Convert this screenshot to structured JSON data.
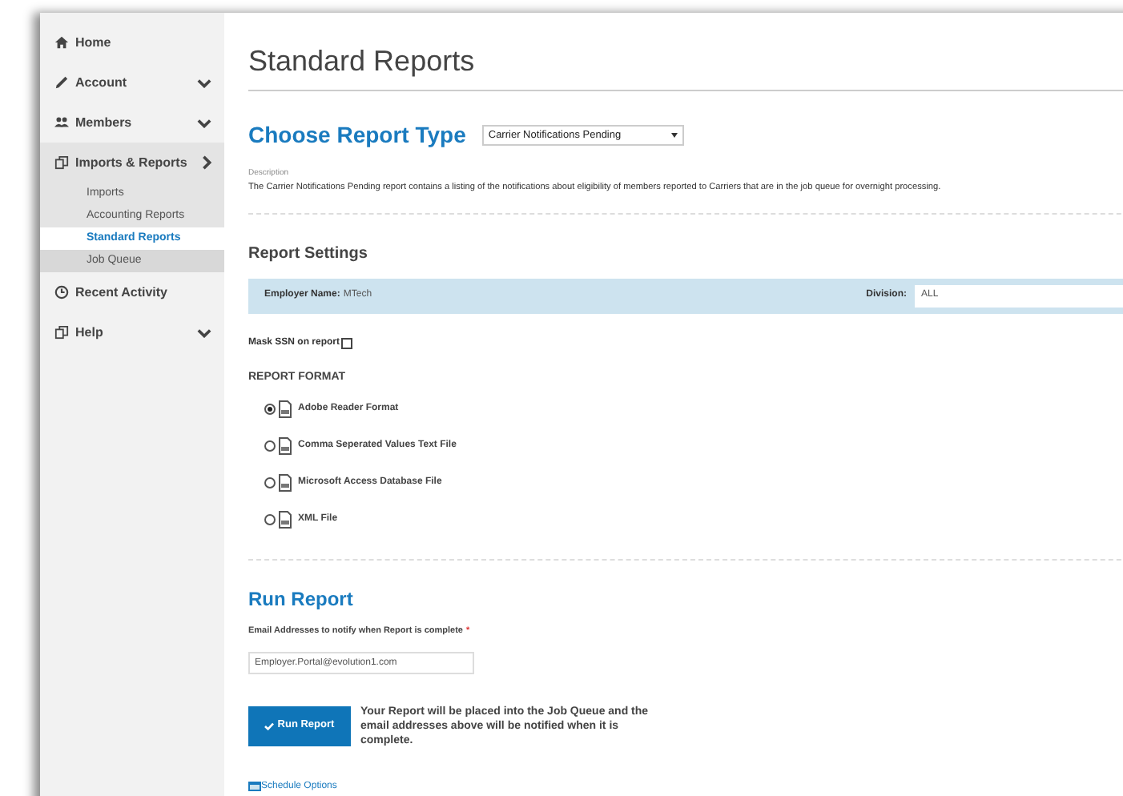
{
  "sidebar": {
    "items": [
      {
        "label": "Home",
        "kind": "home",
        "expandable": false,
        "expanded": false
      },
      {
        "label": "Account",
        "kind": "pencil",
        "expandable": true,
        "expanded": false
      },
      {
        "label": "Members",
        "kind": "users",
        "expandable": true,
        "expanded": false
      },
      {
        "label": "Imports & Reports",
        "kind": "copy",
        "expandable": true,
        "expanded": true,
        "children": [
          {
            "label": "Imports",
            "selected": false,
            "hovered": false
          },
          {
            "label": "Accounting Reports",
            "selected": false,
            "hovered": false
          },
          {
            "label": "Standard Reports",
            "selected": true,
            "hovered": false
          },
          {
            "label": "Job Queue",
            "selected": false,
            "hovered": true
          }
        ]
      },
      {
        "label": "Recent Activity",
        "kind": "clock",
        "expandable": false,
        "expanded": false
      },
      {
        "label": "Help",
        "kind": "copy",
        "expandable": true,
        "expanded": false
      }
    ]
  },
  "page_title": "Standard Reports",
  "choose": {
    "heading": "Choose Report Type",
    "select_value": "Carrier Notifications Pending",
    "description_label": "Description",
    "description": "The Carrier Notifications Pending report contains a listing of the notifications about eligibility of members reported to Carriers that are in the job queue for overnight processing."
  },
  "settings": {
    "heading": "Report Settings",
    "employer_label": "Employer Name:",
    "employer_value": "MTech",
    "division_label": "Division:",
    "division_value": "ALL",
    "mask_label": "Mask SSN on report",
    "mask_checked": false,
    "format_heading": "REPORT FORMAT",
    "formats": [
      {
        "label": "Adobe Reader Format",
        "selected": true
      },
      {
        "label": "Comma Seperated Values Text File",
        "selected": false
      },
      {
        "label": "Microsoft Access Database File",
        "selected": false
      },
      {
        "label": "XML File",
        "selected": false
      }
    ]
  },
  "run": {
    "heading": "Run Report",
    "email_label": "Email Addresses to notify when Report is complete",
    "required_mark": "*",
    "email_value": "Employer.Portal@evolution1.com",
    "button": "Run Report",
    "note": "Your Report will be placed into the Job Queue and the email addresses above will be notified when it is complete.",
    "schedule_link": "Schedule Options"
  }
}
